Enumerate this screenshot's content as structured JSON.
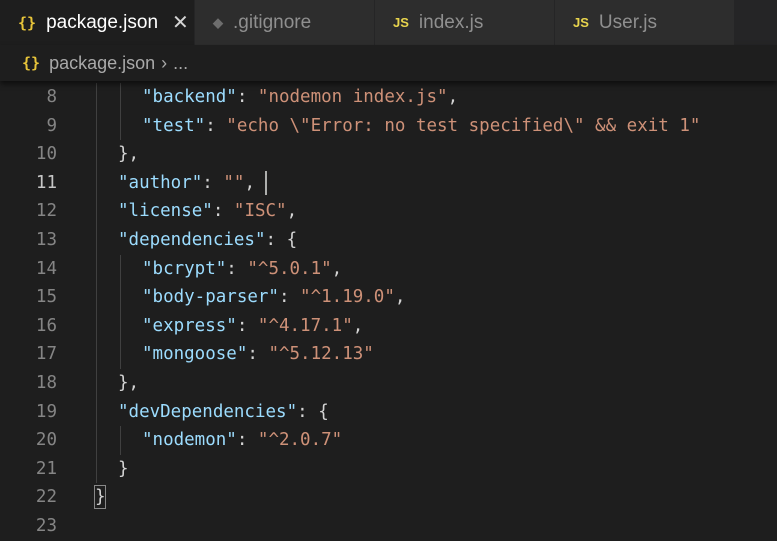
{
  "tabs": [
    {
      "label": "package.json",
      "icon": "{}",
      "icon_name": "json-file-icon",
      "active": true,
      "close": "✕"
    },
    {
      "label": ".gitignore",
      "icon": "◆",
      "icon_name": "git-file-icon"
    },
    {
      "label": "index.js",
      "icon": "JS",
      "icon_name": "js-file-icon"
    },
    {
      "label": "User.js",
      "icon": "JS",
      "icon_name": "js-file-icon"
    }
  ],
  "breadcrumb": {
    "icon": "{}",
    "file": "package.json",
    "separator": "›",
    "more": "..."
  },
  "editor": {
    "current_line": 11,
    "lines": [
      {
        "n": "8",
        "tokens": [
          {
            "t": "\"backend\"",
            "c": "k"
          },
          {
            "t": ": ",
            "c": "p"
          },
          {
            "t": "\"nodemon index.js\"",
            "c": "s"
          },
          {
            "t": ",",
            "c": "p"
          }
        ]
      },
      {
        "n": "9",
        "tokens": [
          {
            "t": "\"test\"",
            "c": "k"
          },
          {
            "t": ": ",
            "c": "p"
          },
          {
            "t": "\"echo \\\"Error: no test specified\\\" && exit 1\"",
            "c": "s"
          }
        ]
      },
      {
        "n": "10",
        "tokens": [
          {
            "t": "},",
            "c": "p"
          }
        ]
      },
      {
        "n": "11",
        "tokens": [
          {
            "t": "\"author\"",
            "c": "k"
          },
          {
            "t": ": ",
            "c": "p"
          },
          {
            "t": "\"\"",
            "c": "s"
          },
          {
            "t": ",",
            "c": "p"
          }
        ]
      },
      {
        "n": "12",
        "tokens": [
          {
            "t": "\"license\"",
            "c": "k"
          },
          {
            "t": ": ",
            "c": "p"
          },
          {
            "t": "\"ISC\"",
            "c": "s"
          },
          {
            "t": ",",
            "c": "p"
          }
        ]
      },
      {
        "n": "13",
        "tokens": [
          {
            "t": "\"dependencies\"",
            "c": "k"
          },
          {
            "t": ": {",
            "c": "p"
          }
        ]
      },
      {
        "n": "14",
        "tokens": [
          {
            "t": "\"bcrypt\"",
            "c": "k"
          },
          {
            "t": ": ",
            "c": "p"
          },
          {
            "t": "\"^5.0.1\"",
            "c": "s"
          },
          {
            "t": ",",
            "c": "p"
          }
        ]
      },
      {
        "n": "15",
        "tokens": [
          {
            "t": "\"body-parser\"",
            "c": "k"
          },
          {
            "t": ": ",
            "c": "p"
          },
          {
            "t": "\"^1.19.0\"",
            "c": "s"
          },
          {
            "t": ",",
            "c": "p"
          }
        ]
      },
      {
        "n": "16",
        "tokens": [
          {
            "t": "\"express\"",
            "c": "k"
          },
          {
            "t": ": ",
            "c": "p"
          },
          {
            "t": "\"^4.17.1\"",
            "c": "s"
          },
          {
            "t": ",",
            "c": "p"
          }
        ]
      },
      {
        "n": "17",
        "tokens": [
          {
            "t": "\"mongoose\"",
            "c": "k"
          },
          {
            "t": ": ",
            "c": "p"
          },
          {
            "t": "\"^5.12.13\"",
            "c": "s"
          }
        ]
      },
      {
        "n": "18",
        "tokens": [
          {
            "t": "},",
            "c": "p"
          }
        ]
      },
      {
        "n": "19",
        "tokens": [
          {
            "t": "\"devDependencies\"",
            "c": "k"
          },
          {
            "t": ": {",
            "c": "p"
          }
        ]
      },
      {
        "n": "20",
        "tokens": [
          {
            "t": "\"nodemon\"",
            "c": "k"
          },
          {
            "t": ": ",
            "c": "p"
          },
          {
            "t": "\"^2.0.7\"",
            "c": "s"
          }
        ]
      },
      {
        "n": "21",
        "tokens": [
          {
            "t": "}",
            "c": "p"
          }
        ]
      },
      {
        "n": "22",
        "tokens": [
          {
            "t": "}",
            "c": "p"
          }
        ]
      },
      {
        "n": "23",
        "tokens": []
      }
    ]
  },
  "colors": {
    "background": "#1e1e1e",
    "key": "#9cdcfe",
    "string": "#ce9178",
    "punctuation": "#d4d4d4",
    "json_icon": "#e8c53a",
    "js_icon": "#e8d44d"
  }
}
